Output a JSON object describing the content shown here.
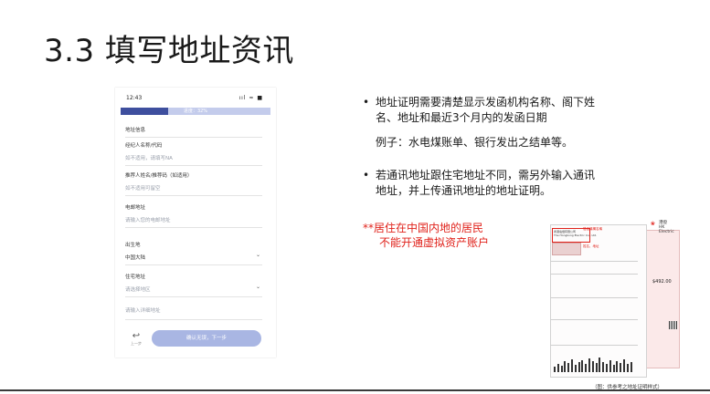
{
  "slide": {
    "title": "3.3 填写地址资讯"
  },
  "phone": {
    "status": {
      "time": "12:43 ",
      "icons": "ııl ≈ ■"
    },
    "progress": {
      "text": "进度：32%",
      "percent": 32
    },
    "section_title": "地址信息",
    "fields": [
      {
        "label": "经纪人名称/代码",
        "value": "如不适用，请填写NA",
        "dropdown": false
      },
      {
        "label": "推荐人姓名/推荐码（如适用）",
        "value": "如不适用可留空",
        "dropdown": false
      },
      {
        "label": "电邮地址",
        "value": "请输入您的电邮地址",
        "dropdown": false
      },
      {
        "label": "出生地",
        "value": "中国大陆",
        "dropdown": true
      },
      {
        "label": "住宅地址",
        "value": "请选择地区",
        "dropdown": true
      },
      {
        "label": "",
        "value": "请输入详细地址",
        "dropdown": false
      }
    ],
    "back_label": "上一步",
    "next_button": "确认无误，下一步"
  },
  "bullets": {
    "b1": [
      "地址证明需要清楚显示发函机构名称、阁下姓",
      "名、地址和最近3个月内的发函日期"
    ],
    "example": "例子：水电煤账单、银行发出之结单等。",
    "b2": [
      "若通讯地址跟住宅地址不同，需另外输入通讯",
      "地址，并上传通讯地址的地址证明。"
    ]
  },
  "warning": {
    "line1": "**居住在中国内地的居民",
    "line2": "不能开通虚拟资产账户"
  },
  "bill": {
    "issuer_cn": "香港電燈有限公司",
    "issuer_en": "The Hongkong Electric Co., Ltd.",
    "note_top": "發函機構名稱",
    "note_name": "姓名、地址",
    "logo_cn": "港燈",
    "logo_en": "HK Electric",
    "amount": "$492.00",
    "caption": "（图：供参考之地址证明样式）"
  },
  "colors": {
    "progress_fill": "#3e4f9e",
    "progress_track": "#c4ccec",
    "next_button": "#a9b6e3",
    "warning": "#e0221b"
  }
}
